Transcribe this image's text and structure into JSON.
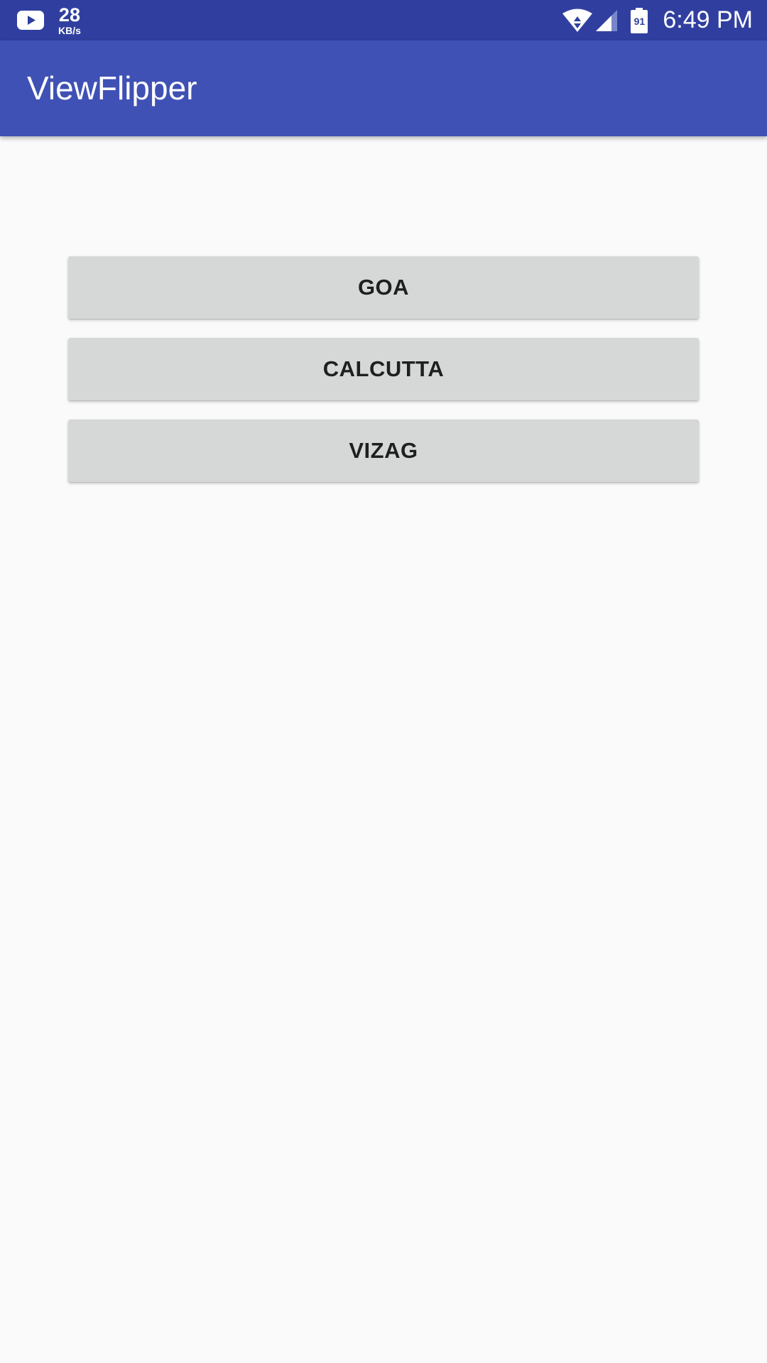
{
  "status_bar": {
    "notification_icon": "youtube-icon",
    "net_speed_value": "28",
    "net_speed_unit": "KB/s",
    "wifi_icon": "wifi-icon",
    "signal_icon": "cell-signal-icon",
    "battery_level": "91",
    "time": "6:49 PM"
  },
  "app_bar": {
    "title": "ViewFlipper"
  },
  "buttons": [
    {
      "label": "GOA"
    },
    {
      "label": "CALCUTTA"
    },
    {
      "label": "VIZAG"
    }
  ],
  "colors": {
    "status_bar": "#303f9f",
    "app_bar": "#3f51b5",
    "background": "#fafafa",
    "button": "#d6d7d7",
    "button_text": "#1f1f1f"
  }
}
